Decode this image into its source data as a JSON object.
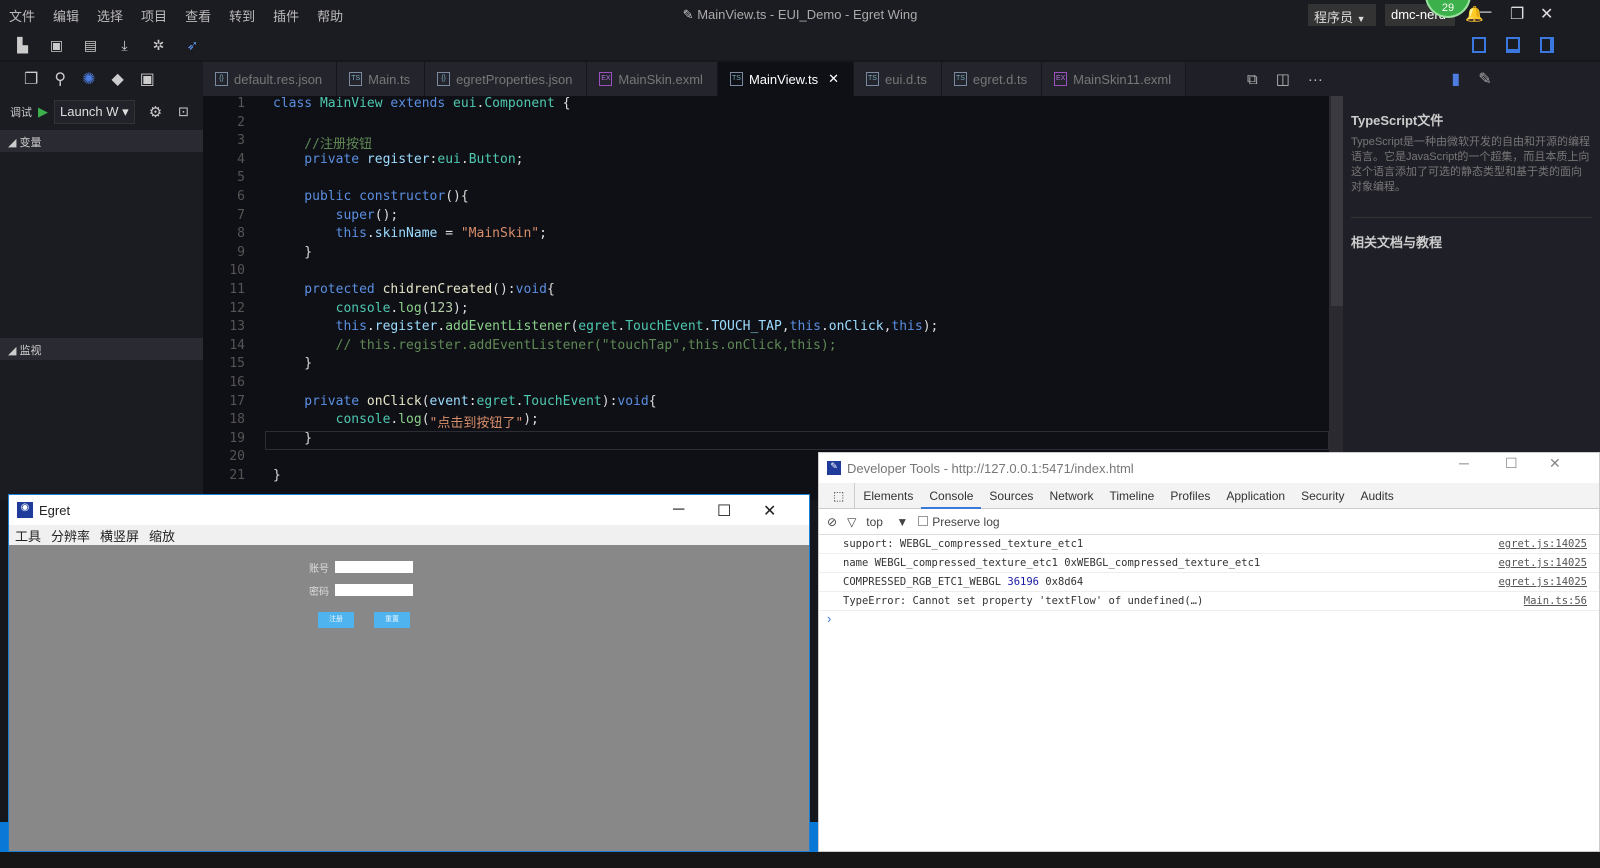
{
  "menu": [
    "文件",
    "编辑",
    "选择",
    "项目",
    "查看",
    "转到",
    "插件",
    "帮助"
  ],
  "window_title": "MainView.ts - EUI_Demo - Egret Wing",
  "role": "程序员",
  "user": "dmc-nerd",
  "notifications": "29",
  "tabs": [
    {
      "label": "default.res.json",
      "icon": "json-file-icon"
    },
    {
      "label": "Main.ts",
      "icon": "ts-file-icon"
    },
    {
      "label": "egretProperties.json",
      "icon": "json-file-icon"
    },
    {
      "label": "MainSkin.exml",
      "icon": "exml-file-icon"
    },
    {
      "label": "MainView.ts",
      "icon": "ts-file-icon",
      "active": true
    },
    {
      "label": "eui.d.ts",
      "icon": "ts-file-icon"
    },
    {
      "label": "egret.d.ts",
      "icon": "ts-file-icon"
    },
    {
      "label": "MainSkin11.exml",
      "icon": "exml-file-icon"
    }
  ],
  "debug": {
    "label": "调试",
    "config": "Launch W"
  },
  "sections": {
    "variables": "变量",
    "watch": "监视"
  },
  "right_panel": {
    "title": "TypeScript文件",
    "desc": "TypeScript是一种由微软开发的自由和开源的编程语言。它是JavaScript的一个超集，而且本质上向这个语言添加了可选的静态类型和基于类的面向对象编程。",
    "docs": "相关文档与教程"
  },
  "code": [
    [
      [
        "class ",
        "kw"
      ],
      [
        "MainView ",
        "ty"
      ],
      [
        "extends ",
        "kw"
      ],
      [
        "eui",
        "ty"
      ],
      [
        ".",
        "pl"
      ],
      [
        "Component ",
        "ty"
      ],
      [
        "{",
        "pl"
      ]
    ],
    [],
    [
      [
        "    //注册按钮",
        "cm"
      ]
    ],
    [
      [
        "    private ",
        "kw"
      ],
      [
        "register",
        "pr"
      ],
      [
        ":",
        "pl"
      ],
      [
        "eui",
        "ty"
      ],
      [
        ".",
        "pl"
      ],
      [
        "Button",
        "ty"
      ],
      [
        ";",
        "pl"
      ]
    ],
    [],
    [
      [
        "    public ",
        "kw"
      ],
      [
        "constructor",
        "kw"
      ],
      [
        "(){",
        "pl"
      ]
    ],
    [
      [
        "        super",
        "kw"
      ],
      [
        "();",
        "pl"
      ]
    ],
    [
      [
        "        this",
        "kw"
      ],
      [
        ".",
        "pl"
      ],
      [
        "skinName",
        "pr"
      ],
      [
        " = ",
        "pl"
      ],
      [
        "\"MainSkin\"",
        "st"
      ],
      [
        ";",
        "pl"
      ]
    ],
    [
      [
        "    }",
        "pl"
      ]
    ],
    [],
    [
      [
        "    protected ",
        "kw"
      ],
      [
        "chidrenCreated",
        "fn"
      ],
      [
        "():",
        "pl"
      ],
      [
        "void",
        "kw"
      ],
      [
        "{",
        "pl"
      ]
    ],
    [
      [
        "        console",
        "ty"
      ],
      [
        ".",
        "pl"
      ],
      [
        "log",
        "mt"
      ],
      [
        "(",
        "pl"
      ],
      [
        "123",
        "nm"
      ],
      [
        ");",
        "pl"
      ]
    ],
    [
      [
        "        this",
        "kw"
      ],
      [
        ".",
        "pl"
      ],
      [
        "register",
        "pr"
      ],
      [
        ".",
        "pl"
      ],
      [
        "addEventListener",
        "mt"
      ],
      [
        "(",
        "pl"
      ],
      [
        "egret",
        "ty"
      ],
      [
        ".",
        "pl"
      ],
      [
        "TouchEvent",
        "ty"
      ],
      [
        ".",
        "pl"
      ],
      [
        "TOUCH_TAP",
        "pr"
      ],
      [
        ",",
        "pl"
      ],
      [
        "this",
        "kw"
      ],
      [
        ".",
        "pl"
      ],
      [
        "onClick",
        "pr"
      ],
      [
        ",",
        "pl"
      ],
      [
        "this",
        "kw"
      ],
      [
        ");",
        "pl"
      ]
    ],
    [
      [
        "        // this.register.addEventListener(\"touchTap\",this.onClick,this);",
        "cm"
      ]
    ],
    [
      [
        "    }",
        "pl"
      ]
    ],
    [],
    [
      [
        "    private ",
        "kw"
      ],
      [
        "onClick",
        "fn"
      ],
      [
        "(",
        "pl"
      ],
      [
        "event",
        "pr"
      ],
      [
        ":",
        "pl"
      ],
      [
        "egret",
        "ty"
      ],
      [
        ".",
        "pl"
      ],
      [
        "TouchEvent",
        "ty"
      ],
      [
        "):",
        "pl"
      ],
      [
        "void",
        "kw"
      ],
      [
        "{",
        "pl"
      ]
    ],
    [
      [
        "        console",
        "ty"
      ],
      [
        ".",
        "pl"
      ],
      [
        "log",
        "mt"
      ],
      [
        "(",
        "pl"
      ],
      [
        "\"点击到按钮了\"",
        "st"
      ],
      [
        ");",
        "pl"
      ]
    ],
    [
      [
        "    }",
        "pl"
      ]
    ],
    [],
    [
      [
        "}",
        "pl"
      ]
    ]
  ],
  "egret": {
    "title": "Egret",
    "menu": [
      "工具",
      "分辨率",
      "横竖屏",
      "缩放"
    ],
    "account": "账号",
    "password": "密码",
    "btn1": "注册",
    "btn2": "重置"
  },
  "devtools": {
    "title": "Developer Tools - http://127.0.0.1:5471/index.html",
    "tabs": [
      "Elements",
      "Console",
      "Sources",
      "Network",
      "Timeline",
      "Profiles",
      "Application",
      "Security",
      "Audits"
    ],
    "active_tab": "Console",
    "context": "top",
    "preserve_log": "Preserve log",
    "logs": [
      {
        "pre": "support: WEBGL_compressed_texture_etc1",
        "num": "",
        "post": "",
        "src": "egret.js:14025"
      },
      {
        "pre": "name WEBGL_compressed_texture_etc1 0xWEBGL_compressed_texture_etc1",
        "num": "",
        "post": "",
        "src": "egret.js:14025"
      },
      {
        "pre": "COMPRESSED_RGB_ETC1_WEBGL ",
        "num": "36196",
        "post": " 0x8d64",
        "src": "egret.js:14025"
      },
      {
        "pre": "TypeError: Cannot set property 'textFlow' of undefined(…)",
        "num": "",
        "post": "",
        "src": "Main.ts:56"
      }
    ],
    "prompt": "›"
  }
}
